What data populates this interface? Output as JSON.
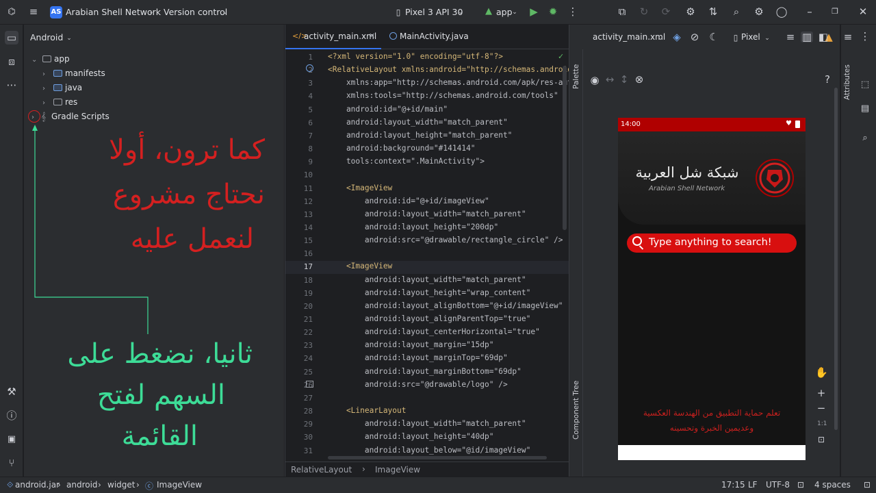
{
  "titlebar": {
    "project_badge": "AS",
    "project_name": "Arabian Shell Network",
    "vcs": "Version control",
    "device": "Pixel 3 API 30",
    "run_config": "app"
  },
  "project_panel": {
    "view": "Android",
    "tree": [
      {
        "label": "app",
        "level": 0,
        "expanded": true
      },
      {
        "label": "manifests",
        "level": 1
      },
      {
        "label": "java",
        "level": 1
      },
      {
        "label": "res",
        "level": 1
      },
      {
        "label": "Gradle Scripts",
        "level": 0
      }
    ],
    "annotation_top": [
      "كما ترون، أولا",
      "نحتاج مشروع",
      "لنعمل عليه"
    ],
    "annotation_bottom": [
      "ثانيا، نضغط على",
      "السهم لفتح",
      "القائمة"
    ],
    "colors": {
      "red": "#d42020",
      "green": "#3ddc97"
    }
  },
  "editor": {
    "tabs": [
      {
        "label": "activity_main.xml",
        "active": true
      },
      {
        "label": "MainActivity.java",
        "active": false
      }
    ],
    "lines": [
      {
        "n": "1",
        "text": "<?xml version=\"1.0\" encoding=\"utf-8\"?>"
      },
      {
        "n": "2",
        "text": "<RelativeLayout xmlns:android=\"http://schemas.android"
      },
      {
        "n": "3",
        "text": "    xmlns:app=\"http://schemas.android.com/apk/res-aut"
      },
      {
        "n": "4",
        "text": "    xmlns:tools=\"http://schemas.android.com/tools\""
      },
      {
        "n": "5",
        "text": "    android:id=\"@+id/main\""
      },
      {
        "n": "6",
        "text": "    android:layout_width=\"match_parent\""
      },
      {
        "n": "7",
        "text": "    android:layout_height=\"match_parent\""
      },
      {
        "n": "8",
        "text": "    android:background=\"#141414\""
      },
      {
        "n": "9",
        "text": "    tools:context=\".MainActivity\">"
      },
      {
        "n": "10",
        "text": ""
      },
      {
        "n": "11",
        "text": "    <ImageView"
      },
      {
        "n": "12",
        "text": "        android:id=\"@+id/imageView\""
      },
      {
        "n": "13",
        "text": "        android:layout_width=\"match_parent\""
      },
      {
        "n": "14",
        "text": "        android:layout_height=\"200dp\""
      },
      {
        "n": "15",
        "text": "        android:src=\"@drawable/rectangle_circle\" />"
      },
      {
        "n": "16",
        "text": ""
      },
      {
        "n": "17",
        "text": "    <ImageView"
      },
      {
        "n": "18",
        "text": "        android:layout_width=\"match_parent\""
      },
      {
        "n": "19",
        "text": "        android:layout_height=\"wrap_content\""
      },
      {
        "n": "20",
        "text": "        android:layout_alignBottom=\"@+id/imageView\""
      },
      {
        "n": "21",
        "text": "        android:layout_alignParentTop=\"true\""
      },
      {
        "n": "22",
        "text": "        android:layout_centerHorizontal=\"true\""
      },
      {
        "n": "23",
        "text": "        android:layout_margin=\"15dp\""
      },
      {
        "n": "24",
        "text": "        android:layout_marginTop=\"69dp\""
      },
      {
        "n": "25",
        "text": "        android:layout_marginBottom=\"69dp\""
      },
      {
        "n": "26",
        "text": "        android:src=\"@drawable/logo\" />"
      },
      {
        "n": "27",
        "text": ""
      },
      {
        "n": "28",
        "text": "    <LinearLayout"
      },
      {
        "n": "29",
        "text": "        android:layout_width=\"match_parent\""
      },
      {
        "n": "30",
        "text": "        android:layout_height=\"40dp\""
      },
      {
        "n": "31",
        "text": "        android:layout_below=\"@id/imageView\""
      }
    ],
    "breadcrumbs": [
      "RelativeLayout",
      "ImageView"
    ]
  },
  "design": {
    "file": "activity_main.xml",
    "device": "Pixel",
    "palette_label": "Palette",
    "component_tree_label": "Component Tree",
    "attributes_label": "Attributes",
    "zoom_ratio": "1:1",
    "phone": {
      "time": "14:00",
      "logo_ar": "شبكة شل العربية",
      "logo_en": "Arabian Shell Network",
      "search_placeholder": "Type anything to search!",
      "footer_line1": "تعلم حماية التطبيق من الهندسة العكسية",
      "footer_line2": "وعديمين الخبرة وتحسينه"
    }
  },
  "statusbar": {
    "path": [
      "android.jar",
      "android",
      "widget",
      "ImageView"
    ],
    "position": "17:15",
    "line_sep": "LF",
    "encoding": "UTF-8",
    "indent": "4 spaces"
  }
}
